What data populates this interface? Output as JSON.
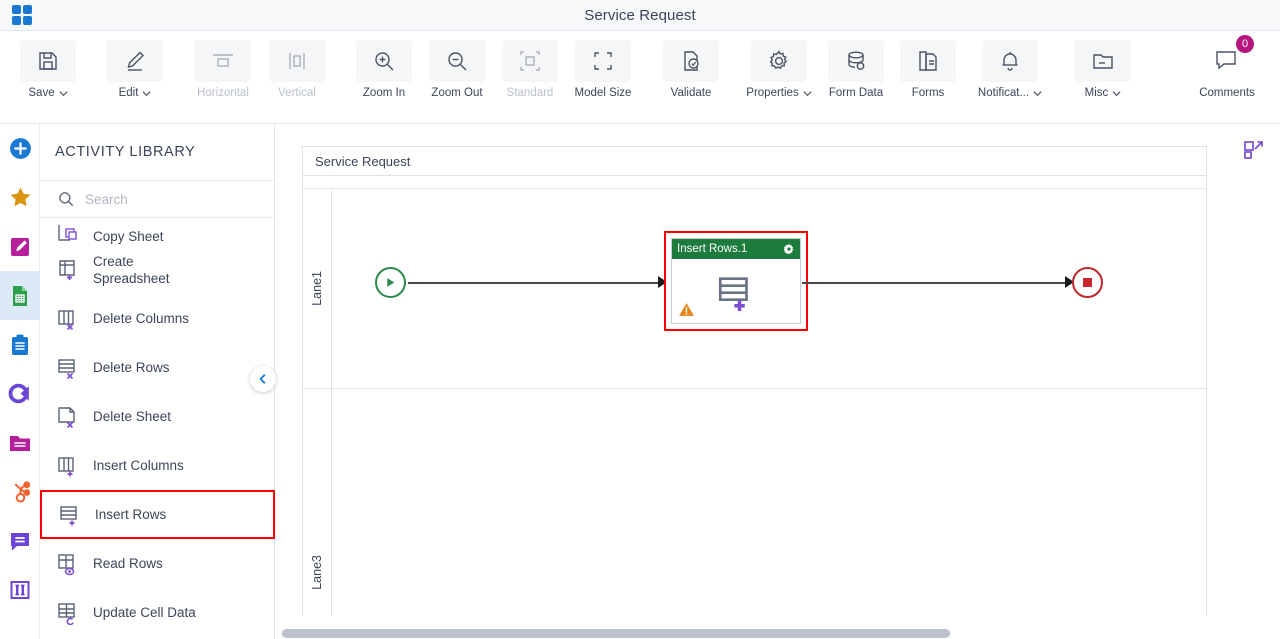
{
  "window": {
    "title": "Service Request",
    "logo_icon": "app-grid-icon"
  },
  "toolbar": {
    "buttons": [
      {
        "label": "Save",
        "icon": "save-floppy-icon",
        "caret": true,
        "disabled": false
      },
      {
        "label": "Edit",
        "icon": "pencil-edit-icon",
        "caret": true,
        "disabled": false
      },
      {
        "label": "Horizontal",
        "icon": "align-horizontal-icon",
        "caret": false,
        "disabled": true
      },
      {
        "label": "Vertical",
        "icon": "align-vertical-icon",
        "caret": false,
        "disabled": true
      },
      {
        "label": "Zoom In",
        "icon": "zoom-in-icon",
        "caret": false,
        "disabled": false
      },
      {
        "label": "Zoom Out",
        "icon": "zoom-out-icon",
        "caret": false,
        "disabled": false
      },
      {
        "label": "Standard",
        "icon": "standard-size-icon",
        "caret": false,
        "disabled": true
      },
      {
        "label": "Model Size",
        "icon": "model-size-icon",
        "caret": false,
        "disabled": false
      },
      {
        "label": "Validate",
        "icon": "validate-check-icon",
        "caret": false,
        "disabled": false
      },
      {
        "label": "Properties",
        "icon": "gear-icon",
        "caret": true,
        "disabled": false
      },
      {
        "label": "Form Data",
        "icon": "database-icon",
        "caret": false,
        "disabled": false
      },
      {
        "label": "Forms",
        "icon": "forms-pages-icon",
        "caret": false,
        "disabled": false
      },
      {
        "label": "Notificat...",
        "icon": "bell-icon",
        "caret": true,
        "disabled": false
      },
      {
        "label": "Misc",
        "icon": "folder-misc-icon",
        "caret": true,
        "disabled": false
      }
    ],
    "comments": {
      "label": "Comments",
      "icon": "comment-bubble-icon",
      "badge_count": "0",
      "badge_color": "#b5157f"
    }
  },
  "rail": {
    "items": [
      {
        "name": "add-new",
        "icon": "plus-circle-icon",
        "color": "#1878d2",
        "active": false
      },
      {
        "name": "favorites",
        "icon": "star-icon",
        "color": "#d99411",
        "active": false
      },
      {
        "name": "design",
        "icon": "pencil-square-icon",
        "color": "#b5209a",
        "active": false
      },
      {
        "name": "spreadsheet",
        "icon": "spreadsheet-file-icon",
        "color": "#2e9e4f",
        "active": true
      },
      {
        "name": "clipboard",
        "icon": "clipboard-icon",
        "color": "#1878d2",
        "active": false
      },
      {
        "name": "integration",
        "icon": "circle-arrow-icon",
        "color": "#6b46d6",
        "active": false
      },
      {
        "name": "documents",
        "icon": "folder-lines-icon",
        "color": "#b5209a",
        "active": false
      },
      {
        "name": "hubspot",
        "icon": "hub-network-icon",
        "color": "#f2622d",
        "active": false
      },
      {
        "name": "messages",
        "icon": "chat-lines-icon",
        "color": "#6b46d6",
        "active": false
      },
      {
        "name": "columns",
        "icon": "columns-bracket-icon",
        "color": "#6b46d6",
        "active": false
      }
    ]
  },
  "panel": {
    "title": "ACTIVITY LIBRARY",
    "search": {
      "placeholder": "Search",
      "value": "",
      "icon": "search-icon"
    },
    "collapse_icon": "chevron-left-icon",
    "activities": [
      {
        "label": "Copy Sheet",
        "icon": "copy-sheet-icon",
        "clipped": true,
        "highlight": false
      },
      {
        "label": "Create Spreadsheet",
        "icon": "create-spreadsheet-icon",
        "clipped": false,
        "highlight": false
      },
      {
        "label": "Delete Columns",
        "icon": "delete-columns-icon",
        "clipped": false,
        "highlight": false
      },
      {
        "label": "Delete Rows",
        "icon": "delete-rows-icon",
        "clipped": false,
        "highlight": false
      },
      {
        "label": "Delete Sheet",
        "icon": "delete-sheet-icon",
        "clipped": false,
        "highlight": false
      },
      {
        "label": "Insert Columns",
        "icon": "insert-columns-icon",
        "clipped": false,
        "highlight": false
      },
      {
        "label": "Insert Rows",
        "icon": "insert-rows-icon",
        "clipped": false,
        "highlight": true
      },
      {
        "label": "Read Rows",
        "icon": "read-rows-icon",
        "clipped": false,
        "highlight": false
      },
      {
        "label": "Update Cell Data",
        "icon": "update-cell-data-icon",
        "clipped": false,
        "highlight": false
      }
    ]
  },
  "canvas": {
    "diagram_title": "Service Request",
    "expand_icon": "expand-diagram-icon",
    "lanes": [
      {
        "name": "Lane1"
      },
      {
        "name": "Lane3"
      }
    ],
    "nodes": {
      "start": {
        "icon": "start-play-icon",
        "color": "#2e8b4f"
      },
      "end": {
        "icon": "end-stop-icon",
        "color": "#c0282d"
      },
      "task": {
        "title": "Insert Rows.1",
        "header_color": "#1e7b3e",
        "selection_color": "#ff0000",
        "gear_icon": "gear-icon",
        "warning_icon": "warning-triangle-icon",
        "body_icon": "insert-rows-icon"
      }
    }
  }
}
